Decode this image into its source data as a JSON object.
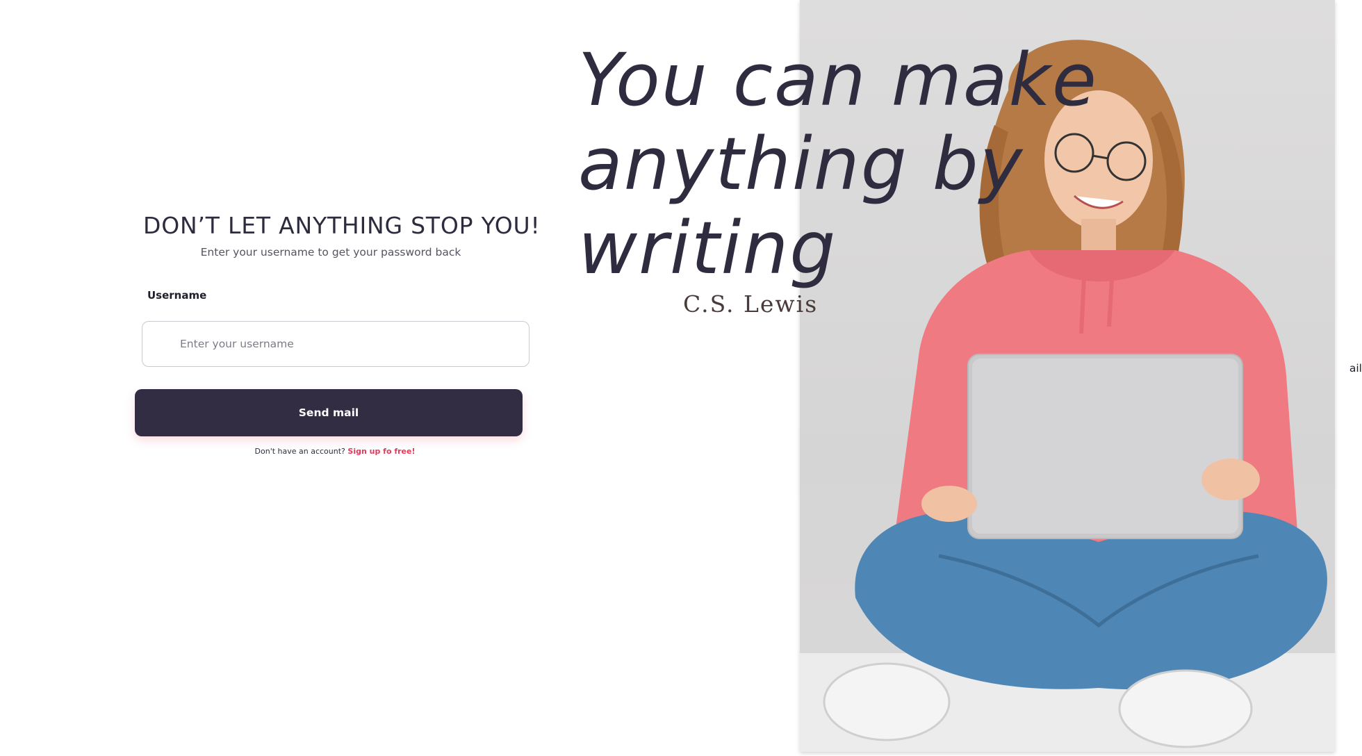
{
  "form": {
    "heading": "DON’T LET ANYTHING STOP YOU!",
    "subheading": "Enter your username to get your password back",
    "username_label": "Username",
    "username_placeholder": "Enter your username",
    "username_value": "",
    "submit_label": "Send mail",
    "signup_prompt": "Don't have an account?",
    "signup_link": "Sign up fo free!"
  },
  "hero": {
    "quote_lines": [
      "You can make",
      "anything by",
      "writing"
    ],
    "author": "C.S. Lewis",
    "image_subject": "woman-with-laptop-photo"
  },
  "overflow_fragment": "ail",
  "colors": {
    "primary_button": "#332d44",
    "link_accent": "#e5385a",
    "heading_text": "#2d2c3f"
  }
}
